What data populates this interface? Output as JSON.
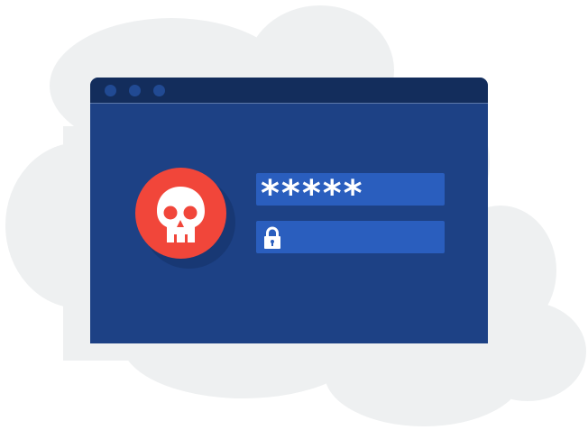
{
  "password_field": {
    "masked_value": "*****"
  },
  "icons": {
    "badge": "skull-icon",
    "lock": "lock-icon"
  },
  "colors": {
    "window": "#1d4185",
    "titlebar": "#132d5c",
    "field": "#2a5ebe",
    "alert": "#f1463a",
    "cloud": "#eef0f1"
  }
}
